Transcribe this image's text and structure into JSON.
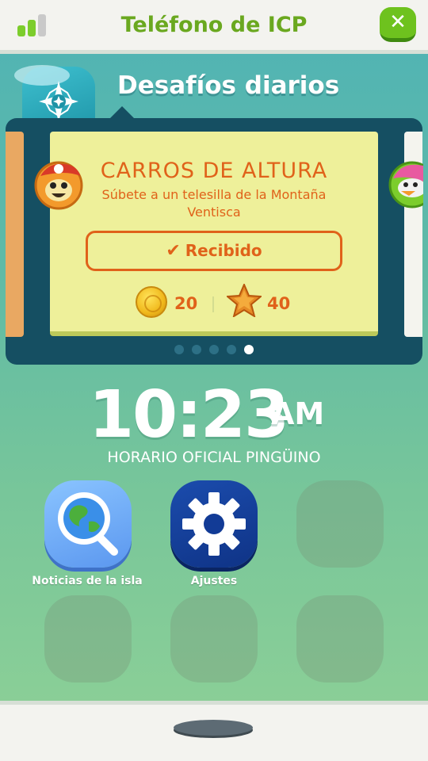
{
  "header": {
    "title": "Teléfono de ICP",
    "close_icon": "close-icon",
    "signal_icon": "signal-bars-icon",
    "accent_color": "#6aa81f"
  },
  "challenges": {
    "heading": "Desafíos diarios",
    "icon": "compass-icon",
    "card": {
      "title": "CARROS DE ALTURA",
      "description": "Súbete a un telesilla de la Montaña Ventisca",
      "status_button": "Recibido",
      "rewards": {
        "coins": "20",
        "stars": "40"
      },
      "text_color": "#e0621a"
    },
    "pagination": {
      "total": 5,
      "active": 5
    }
  },
  "clock": {
    "time": "10:23",
    "period": "AM",
    "caption": "HORARIO OFICIAL PINGÜINO"
  },
  "apps": [
    {
      "label": "Noticias de la isla",
      "icon": "globe-magnifier-icon"
    },
    {
      "label": "Ajustes",
      "icon": "gear-icon"
    }
  ]
}
